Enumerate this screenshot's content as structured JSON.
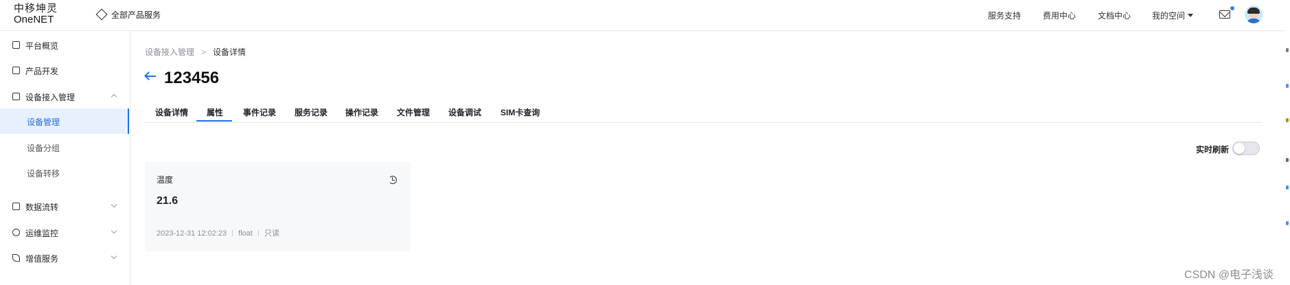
{
  "header": {
    "logo_cn": "中移坤灵",
    "logo_en": "OneNET",
    "all_products": "全部产品服务",
    "nav": [
      "服务支持",
      "费用中心",
      "文档中心",
      "我的空间"
    ]
  },
  "sidebar": {
    "items": [
      {
        "label": "平台概览",
        "icon": "gear-icon"
      },
      {
        "label": "产品开发",
        "icon": "cube-icon"
      },
      {
        "label": "设备接入管理",
        "icon": "device-icon"
      },
      {
        "label": "设备管理"
      },
      {
        "label": "设备分组"
      },
      {
        "label": "设备转移"
      },
      {
        "label": "数据流转",
        "icon": "flow-icon"
      },
      {
        "label": "运维监控",
        "icon": "pie-icon"
      },
      {
        "label": "增值服务",
        "icon": "send-icon"
      }
    ]
  },
  "breadcrumb": {
    "parent": "设备接入管理",
    "separator": ">",
    "current": "设备详情"
  },
  "page": {
    "title": "123456"
  },
  "tabs": [
    "设备详情",
    "属性",
    "事件记录",
    "服务记录",
    "操作记录",
    "文件管理",
    "设备调试",
    "SIM卡查询"
  ],
  "active_tab": "属性",
  "realtime": {
    "label": "实时刷新",
    "enabled": false
  },
  "property_card": {
    "name": "温度",
    "value": "21.6",
    "timestamp": "2023-12-31 12:02:23",
    "type": "float",
    "access": "只读"
  },
  "watermark": "CSDN @电子浅谈",
  "colors": {
    "accent": "#1f6fe5",
    "active_bg": "#e8f0fd",
    "card_bg": "#f6f8fa"
  }
}
